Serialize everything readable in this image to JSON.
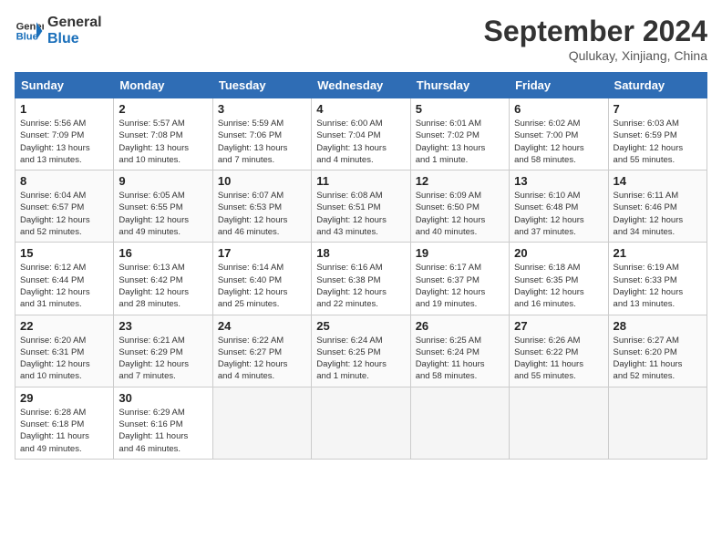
{
  "header": {
    "logo_line1": "General",
    "logo_line2": "Blue",
    "month": "September 2024",
    "location": "Qulukay, Xinjiang, China"
  },
  "weekdays": [
    "Sunday",
    "Monday",
    "Tuesday",
    "Wednesday",
    "Thursday",
    "Friday",
    "Saturday"
  ],
  "weeks": [
    [
      {
        "day": "1",
        "info": "Sunrise: 5:56 AM\nSunset: 7:09 PM\nDaylight: 13 hours\nand 13 minutes."
      },
      {
        "day": "2",
        "info": "Sunrise: 5:57 AM\nSunset: 7:08 PM\nDaylight: 13 hours\nand 10 minutes."
      },
      {
        "day": "3",
        "info": "Sunrise: 5:59 AM\nSunset: 7:06 PM\nDaylight: 13 hours\nand 7 minutes."
      },
      {
        "day": "4",
        "info": "Sunrise: 6:00 AM\nSunset: 7:04 PM\nDaylight: 13 hours\nand 4 minutes."
      },
      {
        "day": "5",
        "info": "Sunrise: 6:01 AM\nSunset: 7:02 PM\nDaylight: 13 hours\nand 1 minute."
      },
      {
        "day": "6",
        "info": "Sunrise: 6:02 AM\nSunset: 7:00 PM\nDaylight: 12 hours\nand 58 minutes."
      },
      {
        "day": "7",
        "info": "Sunrise: 6:03 AM\nSunset: 6:59 PM\nDaylight: 12 hours\nand 55 minutes."
      }
    ],
    [
      {
        "day": "8",
        "info": "Sunrise: 6:04 AM\nSunset: 6:57 PM\nDaylight: 12 hours\nand 52 minutes."
      },
      {
        "day": "9",
        "info": "Sunrise: 6:05 AM\nSunset: 6:55 PM\nDaylight: 12 hours\nand 49 minutes."
      },
      {
        "day": "10",
        "info": "Sunrise: 6:07 AM\nSunset: 6:53 PM\nDaylight: 12 hours\nand 46 minutes."
      },
      {
        "day": "11",
        "info": "Sunrise: 6:08 AM\nSunset: 6:51 PM\nDaylight: 12 hours\nand 43 minutes."
      },
      {
        "day": "12",
        "info": "Sunrise: 6:09 AM\nSunset: 6:50 PM\nDaylight: 12 hours\nand 40 minutes."
      },
      {
        "day": "13",
        "info": "Sunrise: 6:10 AM\nSunset: 6:48 PM\nDaylight: 12 hours\nand 37 minutes."
      },
      {
        "day": "14",
        "info": "Sunrise: 6:11 AM\nSunset: 6:46 PM\nDaylight: 12 hours\nand 34 minutes."
      }
    ],
    [
      {
        "day": "15",
        "info": "Sunrise: 6:12 AM\nSunset: 6:44 PM\nDaylight: 12 hours\nand 31 minutes."
      },
      {
        "day": "16",
        "info": "Sunrise: 6:13 AM\nSunset: 6:42 PM\nDaylight: 12 hours\nand 28 minutes."
      },
      {
        "day": "17",
        "info": "Sunrise: 6:14 AM\nSunset: 6:40 PM\nDaylight: 12 hours\nand 25 minutes."
      },
      {
        "day": "18",
        "info": "Sunrise: 6:16 AM\nSunset: 6:38 PM\nDaylight: 12 hours\nand 22 minutes."
      },
      {
        "day": "19",
        "info": "Sunrise: 6:17 AM\nSunset: 6:37 PM\nDaylight: 12 hours\nand 19 minutes."
      },
      {
        "day": "20",
        "info": "Sunrise: 6:18 AM\nSunset: 6:35 PM\nDaylight: 12 hours\nand 16 minutes."
      },
      {
        "day": "21",
        "info": "Sunrise: 6:19 AM\nSunset: 6:33 PM\nDaylight: 12 hours\nand 13 minutes."
      }
    ],
    [
      {
        "day": "22",
        "info": "Sunrise: 6:20 AM\nSunset: 6:31 PM\nDaylight: 12 hours\nand 10 minutes."
      },
      {
        "day": "23",
        "info": "Sunrise: 6:21 AM\nSunset: 6:29 PM\nDaylight: 12 hours\nand 7 minutes."
      },
      {
        "day": "24",
        "info": "Sunrise: 6:22 AM\nSunset: 6:27 PM\nDaylight: 12 hours\nand 4 minutes."
      },
      {
        "day": "25",
        "info": "Sunrise: 6:24 AM\nSunset: 6:25 PM\nDaylight: 12 hours\nand 1 minute."
      },
      {
        "day": "26",
        "info": "Sunrise: 6:25 AM\nSunset: 6:24 PM\nDaylight: 11 hours\nand 58 minutes."
      },
      {
        "day": "27",
        "info": "Sunrise: 6:26 AM\nSunset: 6:22 PM\nDaylight: 11 hours\nand 55 minutes."
      },
      {
        "day": "28",
        "info": "Sunrise: 6:27 AM\nSunset: 6:20 PM\nDaylight: 11 hours\nand 52 minutes."
      }
    ],
    [
      {
        "day": "29",
        "info": "Sunrise: 6:28 AM\nSunset: 6:18 PM\nDaylight: 11 hours\nand 49 minutes."
      },
      {
        "day": "30",
        "info": "Sunrise: 6:29 AM\nSunset: 6:16 PM\nDaylight: 11 hours\nand 46 minutes."
      },
      {
        "day": "",
        "info": ""
      },
      {
        "day": "",
        "info": ""
      },
      {
        "day": "",
        "info": ""
      },
      {
        "day": "",
        "info": ""
      },
      {
        "day": "",
        "info": ""
      }
    ]
  ]
}
